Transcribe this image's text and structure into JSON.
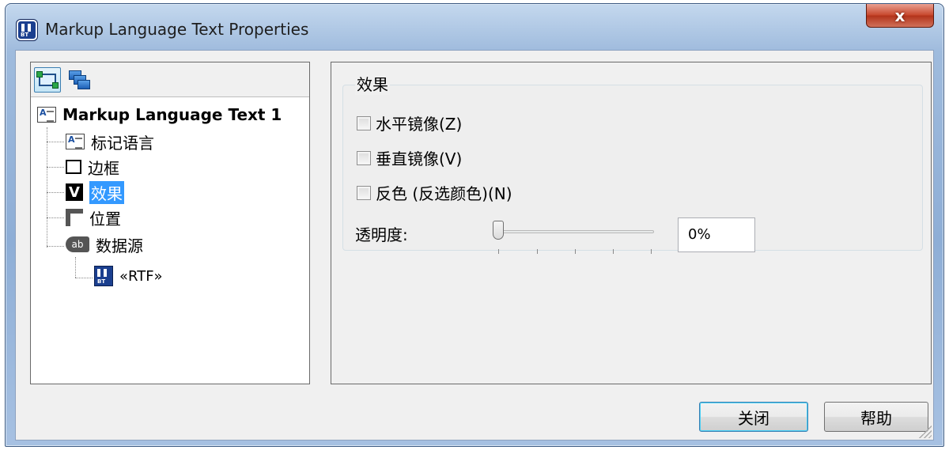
{
  "window": {
    "title": "Markup Language Text Properties",
    "close_glyph": "x"
  },
  "app_icon_text": "BT",
  "left_pane": {
    "toolbar": [
      {
        "name": "object-view-icon",
        "active": true
      },
      {
        "name": "layers-icon",
        "active": false
      }
    ],
    "tree": {
      "root": "Markup Language Text 1",
      "items": [
        {
          "label": "标记语言",
          "icon": "document-icon"
        },
        {
          "label": "边框",
          "icon": "frame-icon"
        },
        {
          "label": "效果",
          "icon": "effect-icon",
          "selected": true
        },
        {
          "label": "位置",
          "icon": "position-icon"
        },
        {
          "label": "数据源",
          "icon": "data-source-icon",
          "icon_text": "ab"
        }
      ],
      "child": {
        "label": "«RTF»",
        "icon": "rtf-icon"
      }
    }
  },
  "effects": {
    "group_title": "效果",
    "options": [
      {
        "label": "水平镜像(Z)",
        "checked": false
      },
      {
        "label": "垂直镜像(V)",
        "checked": false
      },
      {
        "label": "反色 (反选颜色)(N)",
        "checked": false
      }
    ],
    "opacity_label": "透明度:",
    "opacity_value": "0%",
    "opacity_slider": 0
  },
  "buttons": {
    "close": "关闭",
    "help": "帮助"
  }
}
